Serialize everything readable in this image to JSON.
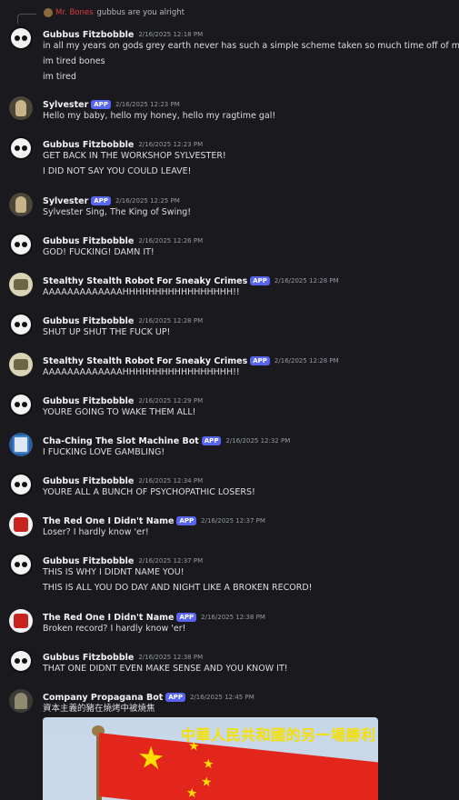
{
  "reply": {
    "author": "Mr. Bones",
    "text": "gubbus are you alright"
  },
  "colors": {
    "background": "#1a1a1e",
    "app_tag": "#5865f2",
    "reply_name": "#d83c3e",
    "caption": "#f5e000"
  },
  "messages": [
    {
      "author": "Gubbus Fitzbobble",
      "avatar": "skull",
      "app": "",
      "time": "2/16/2025 12:18 PM",
      "lines": [
        "in all my years on gods grey earth never has such a simple scheme taken so much time off of my life",
        "im tired bones",
        "im tired"
      ]
    },
    {
      "author": "Sylvester",
      "avatar": "sylvester",
      "app": "APP",
      "time": "2/16/2025 12:23 PM",
      "lines": [
        "Hello my baby, hello my honey, hello my ragtime gal!"
      ]
    },
    {
      "author": "Gubbus Fitzbobble",
      "avatar": "skull",
      "app": "",
      "time": "2/16/2025 12:23 PM",
      "lines": [
        "GET BACK IN THE WORKSHOP SYLVESTER!",
        "I DID NOT SAY YOU COULD LEAVE!"
      ]
    },
    {
      "author": "Sylvester",
      "avatar": "sylvester",
      "app": "APP",
      "time": "2/16/2025 12:25 PM",
      "lines": [
        "Sylvester Sing, The King of Swing!"
      ]
    },
    {
      "author": "Gubbus Fitzbobble",
      "avatar": "skull",
      "app": "",
      "time": "2/16/2025 12:26 PM",
      "lines": [
        "GOD! FUCKING! DAMN IT!"
      ]
    },
    {
      "author": "Stealthy Stealth Robot For Sneaky Crimes",
      "avatar": "stealth",
      "app": "APP",
      "time": "2/16/2025 12:28 PM",
      "lines": [
        "AAAAAAAAAAAAAHHHHHHHHHHHHHHHHH!!"
      ]
    },
    {
      "author": "Gubbus Fitzbobble",
      "avatar": "skull",
      "app": "",
      "time": "2/16/2025 12:28 PM",
      "lines": [
        "SHUT UP SHUT THE FUCK UP!"
      ]
    },
    {
      "author": "Stealthy Stealth Robot For Sneaky Crimes",
      "avatar": "stealth",
      "app": "APP",
      "time": "2/16/2025 12:28 PM",
      "lines": [
        "AAAAAAAAAAAAAHHHHHHHHHHHHHHHHH!!"
      ]
    },
    {
      "author": "Gubbus Fitzbobble",
      "avatar": "skull",
      "app": "",
      "time": "2/16/2025 12:29 PM",
      "lines": [
        "YOURE GOING TO WAKE THEM ALL!"
      ]
    },
    {
      "author": "Cha-Ching The Slot Machine Bot",
      "avatar": "slot",
      "app": "APP",
      "time": "2/16/2025 12:32 PM",
      "lines": [
        "I FUCKING LOVE GAMBLING!"
      ]
    },
    {
      "author": "Gubbus Fitzbobble",
      "avatar": "skull",
      "app": "",
      "time": "2/16/2025 12:34 PM",
      "lines": [
        "YOURE ALL A BUNCH OF PSYCHOPATHIC LOSERS!"
      ]
    },
    {
      "author": "The Red One I Didn't Name",
      "avatar": "red",
      "app": "APP",
      "time": "2/16/2025 12:37 PM",
      "lines": [
        "Loser? I hardly know 'er!"
      ]
    },
    {
      "author": "Gubbus Fitzbobble",
      "avatar": "skull",
      "app": "",
      "time": "2/16/2025 12:37 PM",
      "lines": [
        "THIS IS WHY I DIDNT NAME YOU!",
        "THIS IS ALL YOU DO DAY AND NIGHT LIKE A BROKEN RECORD!"
      ]
    },
    {
      "author": "The Red One I Didn't Name",
      "avatar": "red",
      "app": "APP",
      "time": "2/16/2025 12:38 PM",
      "lines": [
        "Broken record? I hardly know 'er!"
      ]
    },
    {
      "author": "Gubbus Fitzbobble",
      "avatar": "skull",
      "app": "",
      "time": "2/16/2025 12:38 PM",
      "lines": [
        "THAT ONE DIDNT EVEN MAKE SENSE AND YOU KNOW IT!"
      ]
    },
    {
      "author": "Company Propagana Bot",
      "avatar": "propaganda",
      "app": "APP",
      "time": "2/16/2025 12:45 PM",
      "lines": [
        "資本主義的豬在燒烤中被燒焦"
      ]
    }
  ],
  "embed": {
    "caption": "中華人民共和國的另一場勝利"
  }
}
